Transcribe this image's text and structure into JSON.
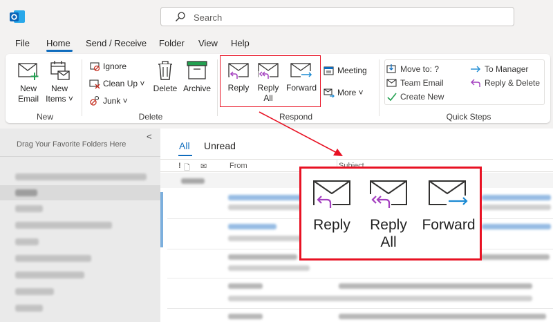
{
  "search": {
    "placeholder": "Search"
  },
  "menu": {
    "tabs": [
      "File",
      "Home",
      "Send / Receive",
      "Folder",
      "View",
      "Help"
    ],
    "active": "Home"
  },
  "ribbon": {
    "new_group": {
      "label": "New",
      "new_email": [
        "New",
        "Email"
      ],
      "new_items": [
        "New",
        "Items ˅"
      ]
    },
    "delete_group": {
      "label": "Delete",
      "ignore": "Ignore",
      "clean_up": "Clean Up ˅",
      "junk": "Junk ˅",
      "delete": "Delete",
      "archive": "Archive"
    },
    "respond_group": {
      "label": "Respond",
      "reply": "Reply",
      "reply_all": [
        "Reply",
        "All"
      ],
      "forward": "Forward",
      "meeting": "Meeting",
      "more": "More ˅"
    },
    "quick_steps": {
      "label": "Quick Steps",
      "move_to": "Move to: ?",
      "team_email": "Team Email",
      "create_new": "Create New",
      "to_manager": "To Manager",
      "reply_delete": "Reply & Delete"
    }
  },
  "folder_pane": {
    "hint": "Drag Your Favorite Folders Here",
    "collapse_glyph": "<"
  },
  "message_list": {
    "tabs": [
      "All",
      "Unread"
    ],
    "active_tab": "All",
    "columns": [
      "!",
      "From",
      "Subject"
    ]
  },
  "callout": {
    "reply": "Reply",
    "reply_all": [
      "Reply",
      "All"
    ],
    "forward": "Forward"
  },
  "colors": {
    "accent": "#0f6cbd",
    "highlight_red": "#e81123",
    "reply_purple": "#a33fbf",
    "forward_blue": "#1b8ad3",
    "green": "#22a050"
  }
}
